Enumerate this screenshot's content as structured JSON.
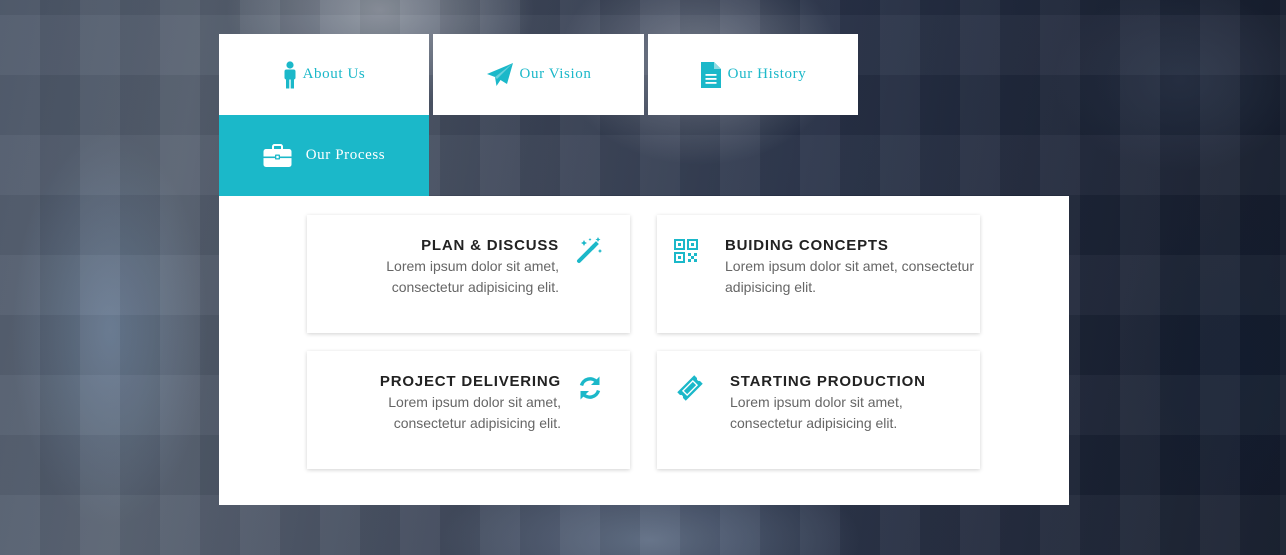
{
  "colors": {
    "accent": "#1bb8c9",
    "card_title": "#222222",
    "card_text": "#666666",
    "panel_bg": "#ffffff"
  },
  "tabs": [
    {
      "label": "About Us",
      "icon": "person-icon",
      "active": false
    },
    {
      "label": "Our Vision",
      "icon": "paper-plane-icon",
      "active": false
    },
    {
      "label": "Our History",
      "icon": "document-icon",
      "active": false
    },
    {
      "label": "Our Process",
      "icon": "briefcase-icon",
      "active": true
    }
  ],
  "cards": [
    {
      "title": "PLAN & DISCUSS",
      "line1": "Lorem ipsum dolor sit amet,",
      "line2": "consectetur adipisicing elit.",
      "icon": "magic-wand-icon"
    },
    {
      "title": "BUIDING CONCEPTS",
      "line1": "Lorem ipsum dolor sit amet, consectetur",
      "line2": "adipisicing elit.",
      "icon": "qrcode-icon"
    },
    {
      "title": "PROJECT DELIVERING",
      "line1": "Lorem ipsum dolor sit amet,",
      "line2": "consectetur adipisicing elit.",
      "icon": "refresh-icon"
    },
    {
      "title": "STARTING PRODUCTION",
      "line1": "Lorem ipsum dolor sit amet,",
      "line2": "consectetur adipisicing elit.",
      "icon": "ticket-icon"
    }
  ]
}
